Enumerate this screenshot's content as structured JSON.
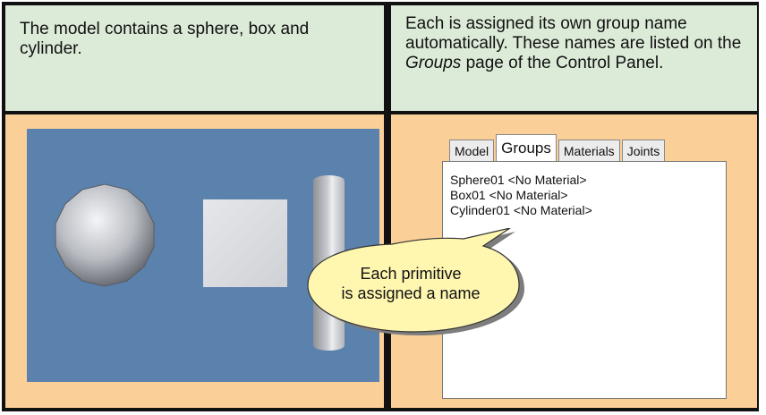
{
  "captions": {
    "left": "The model contains a sphere, box and cylinder.",
    "right_part1": "Each is assigned its own group name automatically. These names are listed on the ",
    "right_italic": "Groups",
    "right_part2": " page of the Control Panel."
  },
  "control_panel": {
    "tabs": [
      {
        "label": "Model",
        "active": false
      },
      {
        "label": "Groups",
        "active": true
      },
      {
        "label": "Materials",
        "active": false
      },
      {
        "label": "Joints",
        "active": false
      }
    ],
    "groups_list": [
      "Sphere01 <No Material>",
      "Box01 <No Material>",
      "Cylinder01 <No Material>"
    ]
  },
  "callout": {
    "line1": "Each primitive",
    "line2": "is assigned a name"
  },
  "colors": {
    "header_bg": "#dcebd8",
    "body_bg": "#fbcf98",
    "viewport_bg": "#5b82ad",
    "callout_fill": "#fff6b0"
  }
}
